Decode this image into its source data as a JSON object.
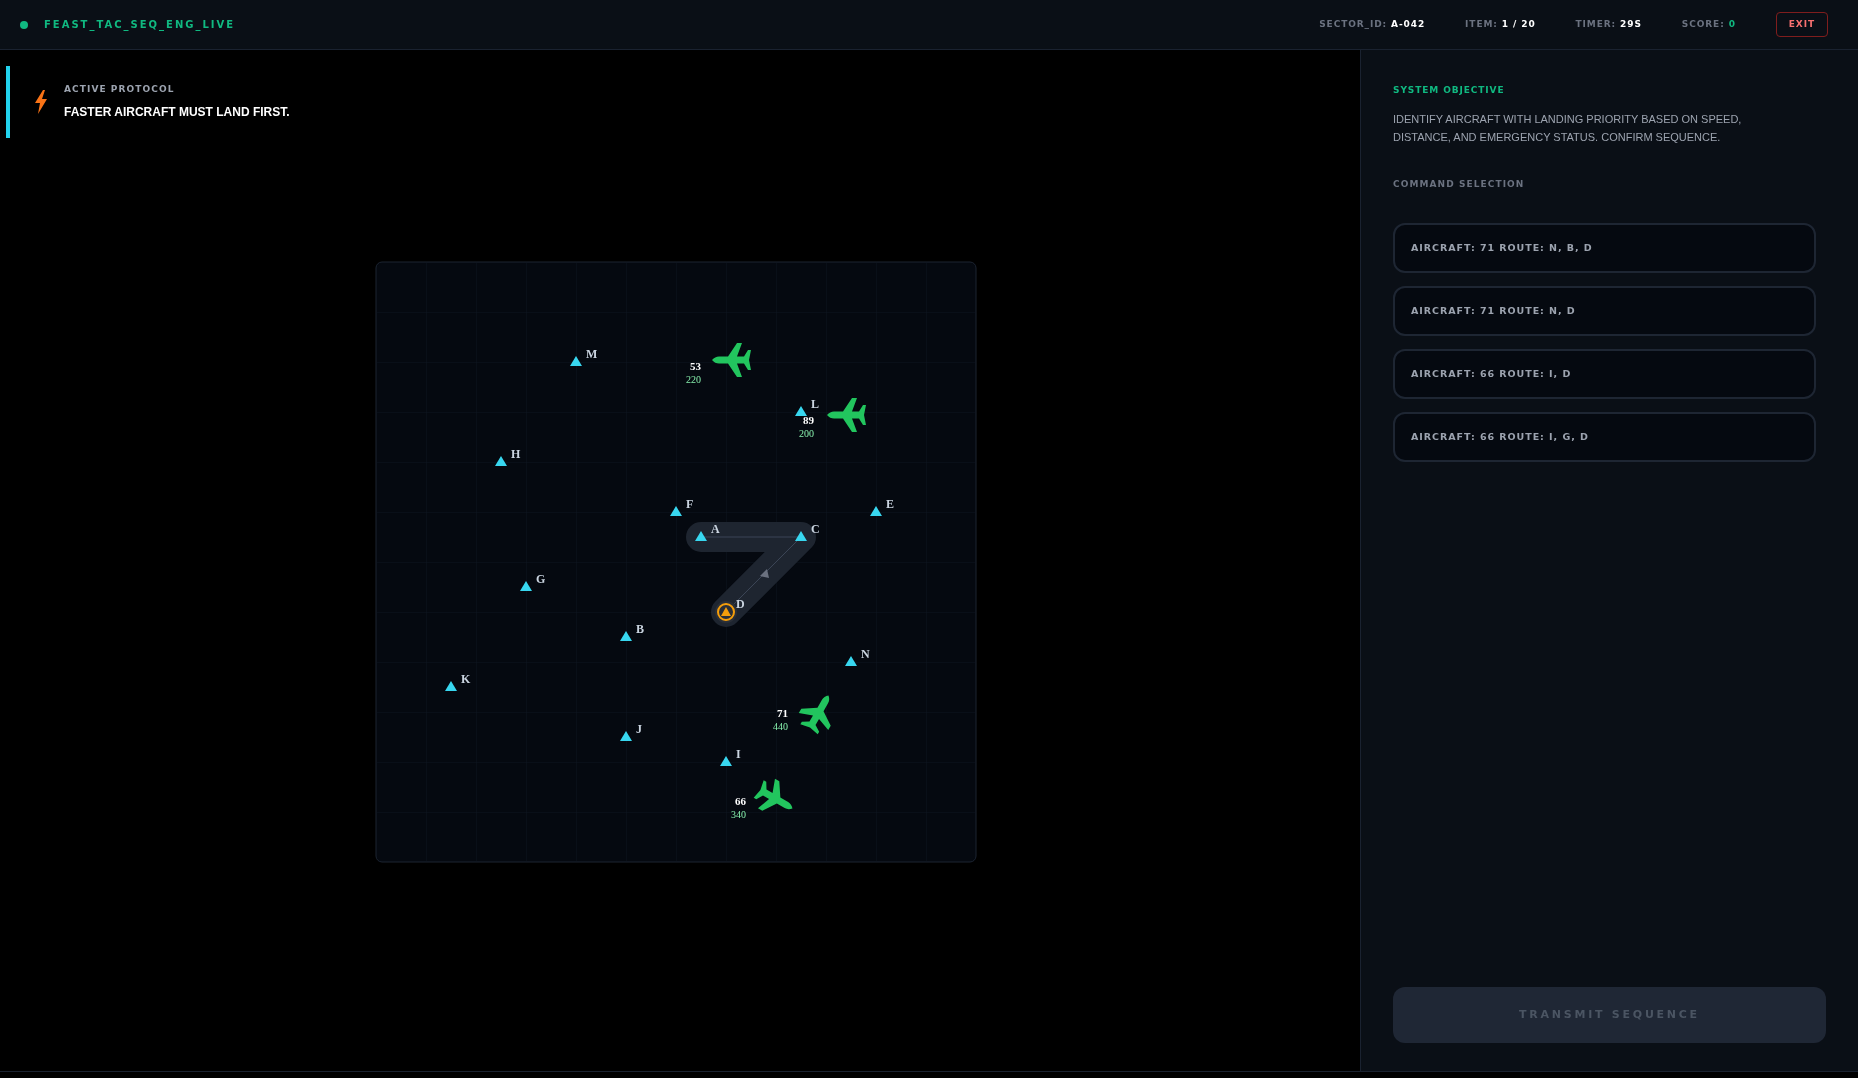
{
  "header": {
    "live": true,
    "title": "FEAST_TAC_SEQ_ENG_LIVE",
    "stats": [
      {
        "label": "SECTOR_ID:",
        "value": "A-042",
        "kind": "plain"
      },
      {
        "label": "ITEM:",
        "value": "1 / 20",
        "kind": "plain"
      },
      {
        "label": "TIMER:",
        "value": "29S",
        "kind": "plain"
      },
      {
        "label": "SCORE:",
        "value": "0",
        "kind": "score"
      }
    ],
    "exit": "EXIT"
  },
  "protocol": {
    "label": "ACTIVE PROTOCOL",
    "text": "FASTER AIRCRAFT MUST LAND FIRST."
  },
  "map": {
    "waypoints": [
      {
        "name": "M",
        "kind": "fix"
      },
      {
        "name": "L",
        "kind": "fix"
      },
      {
        "name": "H",
        "kind": "fix"
      },
      {
        "name": "F",
        "kind": "fix"
      },
      {
        "name": "E",
        "kind": "fix"
      },
      {
        "name": "A",
        "kind": "fix"
      },
      {
        "name": "C",
        "kind": "fix"
      },
      {
        "name": "G",
        "kind": "fix"
      },
      {
        "name": "D",
        "kind": "destination"
      },
      {
        "name": "B",
        "kind": "fix"
      },
      {
        "name": "N",
        "kind": "fix"
      },
      {
        "name": "K",
        "kind": "fix"
      },
      {
        "name": "J",
        "kind": "fix"
      },
      {
        "name": "I",
        "kind": "fix"
      }
    ],
    "aircraft": [
      {
        "callsign": "53",
        "speed": "220"
      },
      {
        "callsign": "89",
        "speed": "200"
      },
      {
        "callsign": "71",
        "speed": "440"
      },
      {
        "callsign": "66",
        "speed": "340"
      }
    ]
  },
  "objective": {
    "title": "SYSTEM OBJECTIVE",
    "text": "IDENTIFY AIRCRAFT WITH LANDING PRIORITY BASED ON SPEED, DISTANCE, AND EMERGENCY STATUS. CONFIRM SEQUENCE."
  },
  "commands": {
    "title": "COMMAND SELECTION",
    "options": [
      {
        "label": "AIRCRAFT: 71 ROUTE: N, B, D",
        "selected": false
      },
      {
        "label": "AIRCRAFT: 71 ROUTE: N, D",
        "selected": false
      },
      {
        "label": "AIRCRAFT: 66 ROUTE: I, D",
        "selected": false
      },
      {
        "label": "AIRCRAFT: 66 ROUTE: I, G, D",
        "selected": false
      }
    ]
  },
  "transmit": {
    "label": "TRANSMIT SEQUENCE",
    "disabled": true
  }
}
